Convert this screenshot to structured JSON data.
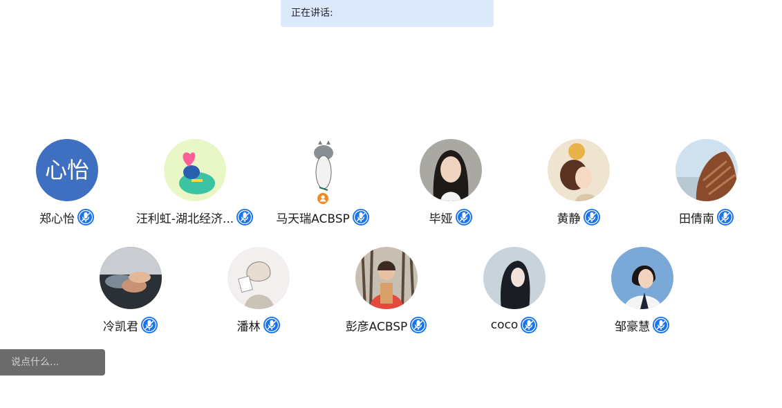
{
  "speaking_bar": {
    "label": "正在讲话:"
  },
  "participants_row1": [
    {
      "name": "郑心怡",
      "avatar_text": "心怡"
    },
    {
      "name": "汪利虹-湖北经济..."
    },
    {
      "name": "马天瑞ACBSP",
      "is_host": true
    },
    {
      "name": "毕娅"
    },
    {
      "name": "黄静"
    },
    {
      "name": "田倩南"
    }
  ],
  "participants_row2": [
    {
      "name": "冷凯君"
    },
    {
      "name": "潘林"
    },
    {
      "name": "彭彦ACBSP"
    },
    {
      "name": "coco"
    },
    {
      "name": "邹豪慧"
    }
  ],
  "chat": {
    "placeholder": "说点什么..."
  },
  "colors": {
    "accent": "#1a73e8",
    "speaking_bg": "#dbe9fb",
    "host_badge": "#f08a24",
    "chat_bg": "#6b6b6b"
  },
  "icons": {
    "mic": "mic-icon",
    "host": "user-icon",
    "emoji": "emoji-icon",
    "collapse": "chevron-left-icon"
  }
}
